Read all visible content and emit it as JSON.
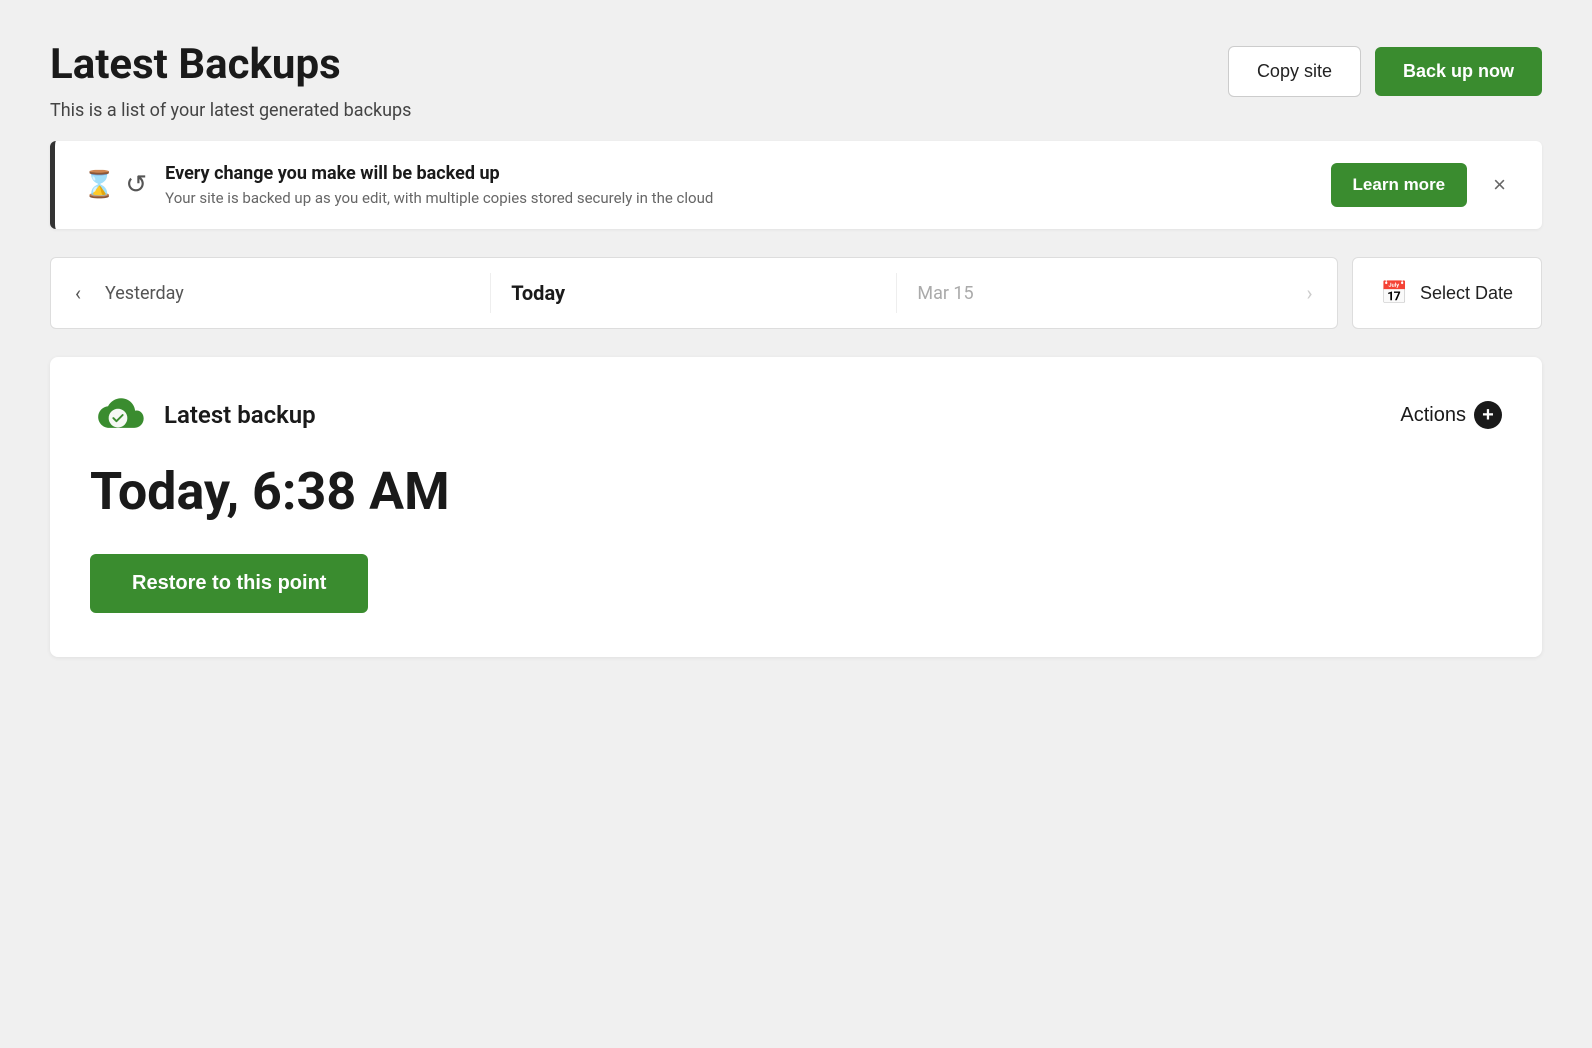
{
  "header": {
    "title": "Latest Backups",
    "subtitle": "This is a list of your latest generated backups",
    "copy_site_label": "Copy site",
    "backup_now_label": "Back up now"
  },
  "info_banner": {
    "headline": "Every change you make will be backed up",
    "subtext": "Your site is backed up as you edit, with multiple copies stored securely in the cloud",
    "learn_more_label": "Learn more",
    "close_label": "×"
  },
  "date_nav": {
    "prev_label": "Yesterday",
    "current_label": "Today",
    "next_label": "Mar 15",
    "select_date_label": "Select Date"
  },
  "backup_card": {
    "badge_label": "Latest backup",
    "actions_label": "Actions",
    "time_label": "Today, 6:38 AM",
    "restore_label": "Restore to this point"
  }
}
